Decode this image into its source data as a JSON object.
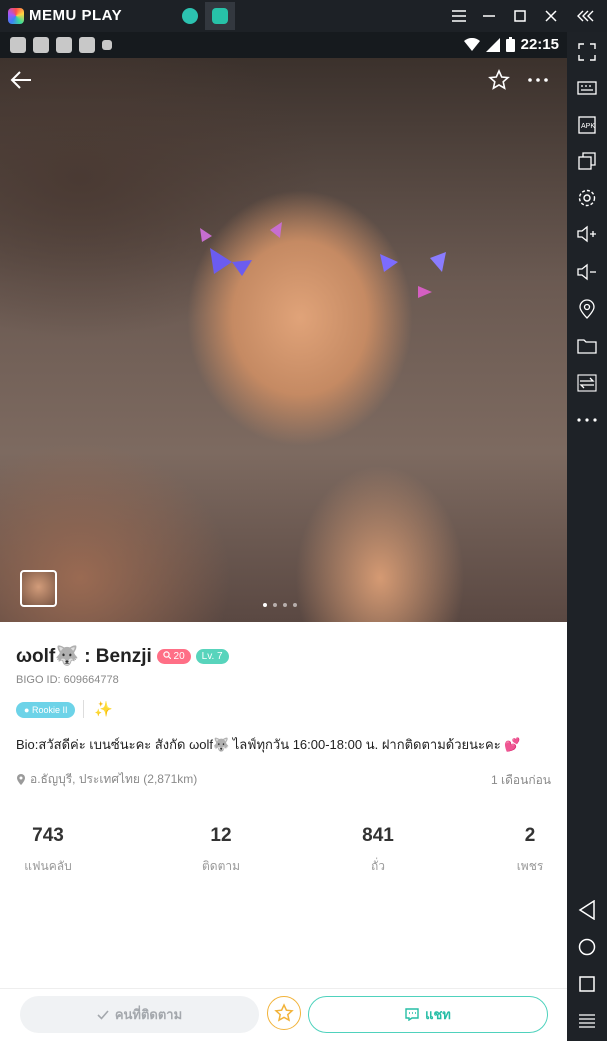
{
  "emulator": {
    "logo_text": "MEMU PLAY",
    "tabs": [
      {
        "icon": "app-tab-icon"
      },
      {
        "icon": "bigo-app-icon"
      }
    ],
    "window_controls": [
      "menu-icon",
      "minimize-icon",
      "maximize-icon",
      "close-icon",
      "collapse-sidebar-icon"
    ],
    "sidebar": [
      "fullscreen-icon",
      "keyboard-icon",
      "apk-icon",
      "multi-window-icon",
      "settings-icon",
      "volume-up-icon",
      "volume-down-icon",
      "location-icon",
      "folder-icon",
      "rotate-icon",
      "more-icon",
      "back-icon",
      "home-icon",
      "recent-apps-icon",
      "menu-lines-icon"
    ]
  },
  "status_bar": {
    "time": "22:15",
    "left_icons": [
      "notification-icon",
      "notification-icon",
      "notification-icon",
      "notification-icon",
      "a-icon"
    ],
    "right_icons": [
      "wifi-icon",
      "signal-icon",
      "battery-icon"
    ]
  },
  "photo": {
    "icons": [
      "back-arrow-icon",
      "star-icon",
      "more-icon"
    ],
    "dots_count": 4,
    "active_dot": 0
  },
  "profile": {
    "name": "ωolf🐺 : Benzji",
    "fans_badge": "20",
    "level_badge": "Lv. 7",
    "bigo_id": "BIGO ID: 609664778",
    "rookie_tag": "Rookie II",
    "bio": "Bio:สวัสดีค่ะ เบนซ์นะคะ สังกัด ωolf🐺 ไลฟ์ทุกวัน 16:00-18:00 น. ฝากติดตามด้วยนะคะ 💕",
    "location": "อ.ธัญบุรี, ประเทศไทย (2,871km)",
    "last_seen": "1 เดือนก่อน",
    "stats": [
      {
        "value": "743",
        "label": "แฟนคลับ"
      },
      {
        "value": "12",
        "label": "ติดตาม"
      },
      {
        "value": "841",
        "label": "ถั่ว"
      },
      {
        "value": "2",
        "label": "เพชร"
      }
    ]
  },
  "bottom": {
    "follow_label": "คนที่ติดตาม",
    "chat_label": "แชท"
  },
  "colors": {
    "accent": "#4fd2bd",
    "fans_badge": "#ff6f86",
    "level_badge": "#58d4bc",
    "rookie": "#6dd3e8",
    "star": "#f2b33a"
  }
}
